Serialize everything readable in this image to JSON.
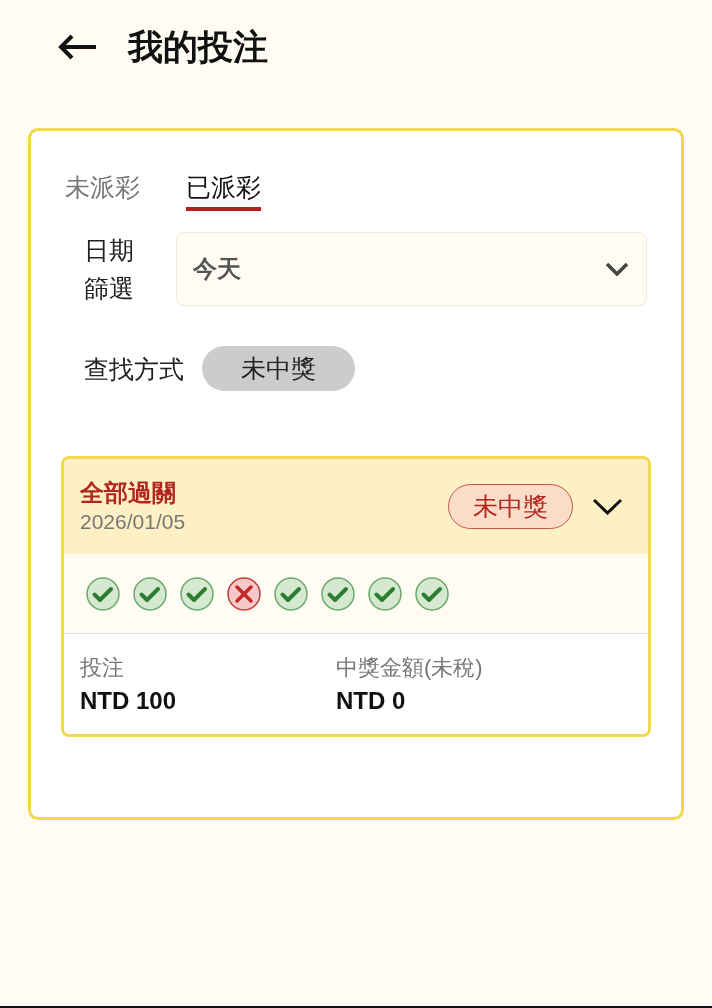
{
  "header": {
    "title": "我的投注"
  },
  "tabs": [
    {
      "label": "未派彩",
      "selected": false
    },
    {
      "label": "已派彩",
      "selected": true
    }
  ],
  "date_filter": {
    "label": "日期篩選",
    "value": "今天"
  },
  "search_method": {
    "label": "查找方式",
    "chip": "未中獎"
  },
  "bets": [
    {
      "title": "全部過關",
      "date": "2026/01/05",
      "status": "未中獎",
      "expanded": false,
      "legs": [
        {
          "won": true
        },
        {
          "won": true
        },
        {
          "won": true
        },
        {
          "won": false
        },
        {
          "won": true
        },
        {
          "won": true
        },
        {
          "won": true
        },
        {
          "won": true
        }
      ],
      "stake_label": "投注",
      "stake": "NTD 100",
      "payout_label": "中獎金額(未稅)",
      "payout": "NTD 0"
    }
  ]
}
